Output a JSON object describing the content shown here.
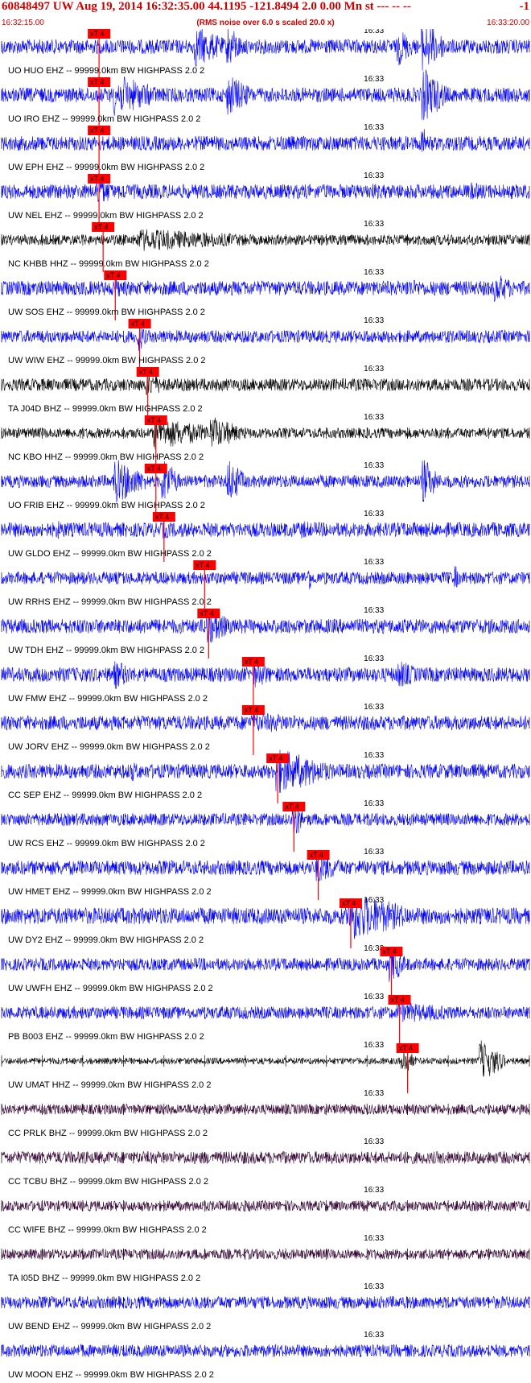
{
  "header": {
    "title": "60848497 UW Aug 19, 2014 16:32:35.00   44.1195 -121.8494  2.0 0.00 Mn st --- -- --",
    "trail": "-1",
    "start_time": "16:32:15.00",
    "end_time": "16:33:20.00",
    "subtitle": "(RMS noise over 6.0 s scaled 20.0 x)"
  },
  "colors": {
    "header": "#cc0000",
    "pick": "#ff0000",
    "blue_trace": "#0000ff",
    "black_trace": "#000000",
    "purple_trace": "#330033",
    "grid": "#000000"
  },
  "chart_data": {
    "type": "line",
    "title": "60848497 UW Aug 19, 2014 16:32:35.00   44.1195 -121.8494  2.0 0.00 Mn st --- -- --",
    "x_range": [
      "16:32:15.00",
      "16:33:20.00"
    ],
    "x_tick_label": "16:33",
    "x_tick_seconds": 45,
    "duration_seconds": 65,
    "pick_label": "xT 4",
    "series": [
      {
        "name": "UO.HUO.EHZ.--",
        "label": "UO HUO EHZ -- 99999.0km BW  HIGHPASS  2.0  2",
        "color": "blue",
        "pick_s": 12.0,
        "amp": 0.35,
        "events": [
          [
            24,
            4,
            1.0
          ],
          [
            28,
            2,
            1.0
          ],
          [
            49,
            2,
            0.9
          ],
          [
            52,
            3,
            1.2
          ],
          [
            61,
            3,
            0.4
          ]
        ]
      },
      {
        "name": "UO.IRO.EHZ.--",
        "label": "UO IRO EHZ -- 99999.0km BW  HIGHPASS  2.0  2",
        "color": "blue",
        "pick_s": 12.0,
        "amp": 0.35,
        "events": [
          [
            14,
            6,
            1.0
          ],
          [
            28,
            3,
            1.0
          ],
          [
            52,
            3,
            1.3
          ]
        ]
      },
      {
        "name": "UW.EPH.EHZ.--",
        "label": "UW EPH EHZ -- 99999.0km BW  HIGHPASS  2.0  2",
        "color": "blue",
        "pick_s": 12.0,
        "amp": 0.35,
        "events": [
          [
            52,
            0.5,
            0.8
          ]
        ]
      },
      {
        "name": "UW.NEL.EHZ.--",
        "label": "UW NEL EHZ -- 99999.0km BW  HIGHPASS  2.0  2",
        "color": "blue",
        "pick_s": 12.0,
        "amp": 0.35,
        "events": [
          [
            12,
            2,
            0.8
          ],
          [
            46,
            3,
            0.4
          ],
          [
            58,
            3,
            0.45
          ]
        ]
      },
      {
        "name": "NC.KHBB.HHZ.--",
        "label": "NC KHBB HHZ -- 99999.0km BW  HIGHPASS  2.0  2",
        "color": "black",
        "pick_s": 12.5,
        "amp": 0.25,
        "events": [
          [
            17,
            18,
            0.55
          ]
        ]
      },
      {
        "name": "UW.SOS.EHZ.--",
        "label": "UW SOS EHZ -- 99999.0km BW  HIGHPASS  2.0  2",
        "color": "blue",
        "pick_s": 14.0,
        "amp": 0.35,
        "events": [
          [
            14,
            2,
            0.5
          ],
          [
            50,
            6,
            0.45
          ],
          [
            61,
            3,
            0.7
          ]
        ]
      },
      {
        "name": "UW.WIW.EHZ.--",
        "label": "UW WIW EHZ -- 99999.0km BW  HIGHPASS  2.0  2",
        "color": "blue",
        "pick_s": 17.0,
        "amp": 0.3,
        "events": [
          [
            17,
            1,
            0.7
          ]
        ]
      },
      {
        "name": "TA.J04D.BHZ.--",
        "label": "TA J04D BHZ -- 99999.0km BW  HIGHPASS  2.0  2",
        "color": "black",
        "pick_s": 18.0,
        "amp": 0.3,
        "events": [
          [
            18,
            3,
            0.6
          ]
        ]
      },
      {
        "name": "NC.KBO.HHZ.--",
        "label": "NC KBO HHZ -- 99999.0km BW  HIGHPASS  2.0  2",
        "color": "black",
        "pick_s": 19.0,
        "amp": 0.25,
        "events": [
          [
            19,
            8,
            0.8
          ],
          [
            26,
            4,
            0.8
          ]
        ]
      },
      {
        "name": "UO.FRIB.EHZ.--",
        "label": "UO FRIB EHZ -- 99999.0km BW  HIGHPASS  2.0  2",
        "color": "blue",
        "pick_s": 19.0,
        "amp": 0.3,
        "events": [
          [
            14,
            4,
            1.1
          ],
          [
            20,
            2,
            1.1
          ],
          [
            28,
            2,
            1.1
          ],
          [
            52,
            2,
            1.1
          ]
        ]
      },
      {
        "name": "UW.GLDO.EHZ.--",
        "label": "UW GLDO EHZ -- 99999.0km BW  HIGHPASS  2.0  2",
        "color": "blue",
        "pick_s": 20.0,
        "amp": 0.35,
        "events": [
          [
            7,
            4,
            0.45
          ],
          [
            20,
            3,
            0.45
          ],
          [
            37,
            4,
            0.45
          ],
          [
            50,
            3,
            0.4
          ]
        ]
      },
      {
        "name": "UW.RRHS.EHZ.--",
        "label": "UW RRHS EHZ -- 99999.0km BW  HIGHPASS  2.0  2",
        "color": "blue",
        "pick_s": 25.0,
        "amp": 0.3,
        "events": [
          [
            25,
            5,
            0.3
          ],
          [
            38,
            0.4,
            0.6
          ],
          [
            56,
            0.4,
            0.6
          ]
        ]
      },
      {
        "name": "UW.TDH.EHZ.--",
        "label": "UW TDH EHZ -- 99999.0km BW  HIGHPASS  2.0  2",
        "color": "blue",
        "pick_s": 25.5,
        "amp": 0.35,
        "events": [
          [
            25.5,
            3,
            0.9
          ]
        ]
      },
      {
        "name": "UW.FMW.EHZ.--",
        "label": "UW FMW EHZ -- 99999.0km BW  HIGHPASS  2.0  2",
        "color": "blue",
        "pick_s": 31.0,
        "amp": 0.35,
        "events": [
          [
            14,
            3,
            0.7
          ],
          [
            31,
            3,
            0.7
          ],
          [
            49,
            3,
            0.7
          ]
        ]
      },
      {
        "name": "UW.JORV.EHZ.--",
        "label": "UW JORV EHZ -- 99999.0km BW  HIGHPASS  2.0  2",
        "color": "blue",
        "pick_s": 31.0,
        "amp": 0.35,
        "events": [
          [
            31,
            14,
            0.5
          ]
        ]
      },
      {
        "name": "CC.SEP.EHZ.--",
        "label": "CC SEP EHZ -- 99999.0km BW  HIGHPASS  2.0  2",
        "color": "blue",
        "pick_s": 34.0,
        "amp": 0.35,
        "events": [
          [
            34,
            7,
            1.1
          ],
          [
            16,
            2,
            0.5
          ]
        ]
      },
      {
        "name": "UW.RCS.EHZ.--",
        "label": "UW RCS EHZ -- 99999.0km BW  HIGHPASS  2.0  2",
        "color": "blue",
        "pick_s": 36.0,
        "amp": 0.3,
        "events": [
          [
            36,
            1.5,
            0.9
          ]
        ]
      },
      {
        "name": "UW.HMET.EHZ.--",
        "label": "UW HMET EHZ -- 99999.0km BW  HIGHPASS  2.0  2",
        "color": "blue",
        "pick_s": 39.0,
        "amp": 0.35,
        "events": [
          [
            39,
            4,
            0.7
          ]
        ]
      },
      {
        "name": "UW.DY2.EHZ.--",
        "label": "UW DY2 EHZ -- 99999.0km BW  HIGHPASS  2.0  2",
        "color": "blue",
        "pick_s": 43.0,
        "amp": 0.4,
        "events": [
          [
            43,
            8,
            1.2
          ]
        ]
      },
      {
        "name": "UW.UWFH.EHZ.--",
        "label": "UW UWFH EHZ -- 99999.0km BW  HIGHPASS  2.0  2",
        "color": "blue",
        "pick_s": 48.0,
        "amp": 0.3,
        "events": [
          [
            48,
            2,
            0.9
          ]
        ]
      },
      {
        "name": "PB.B003.EHZ.--",
        "label": "PB B003 EHZ -- 99999.0km BW  HIGHPASS  2.0  2",
        "color": "blue",
        "pick_s": 49.0,
        "amp": 0.3,
        "events": [
          [
            49,
            12,
            0.5
          ]
        ]
      },
      {
        "name": "UW.UMAT.HHZ.--",
        "label": "UW UMAT HHZ -- 99999.0km BW  HIGHPASS  2.0  2",
        "color": "black",
        "pick_s": 50.0,
        "amp": 0.15,
        "events": [
          [
            49.5,
            1.5,
            0.7
          ],
          [
            59,
            3,
            1.0
          ]
        ]
      },
      {
        "name": "CC.PRLK.BHZ.--",
        "label": "CC PRLK BHZ -- 99999.0km BW  HIGHPASS  2.0  2",
        "color": "purple",
        "amp": 0.25,
        "events": []
      },
      {
        "name": "CC.TCBU.BHZ.--",
        "label": "CC TCBU BHZ -- 99999.0km BW  HIGHPASS  2.0  2",
        "color": "purple",
        "amp": 0.3,
        "events": [
          [
            52,
            8,
            0.25
          ]
        ]
      },
      {
        "name": "CC.WIFE.BHZ.--",
        "label": "CC WIFE BHZ -- 99999.0km BW  HIGHPASS  2.0  2",
        "color": "purple",
        "amp": 0.25,
        "events": []
      },
      {
        "name": "TA.I05D.BHZ.--",
        "label": "TA I05D BHZ -- 99999.0km BW  HIGHPASS  2.0  2",
        "color": "purple",
        "amp": 0.25,
        "events": []
      },
      {
        "name": "UW.BEND.EHZ.--",
        "label": "UW BEND EHZ -- 99999.0km BW  HIGHPASS  2.0  2",
        "color": "blue",
        "amp": 0.3,
        "events": []
      },
      {
        "name": "UW.MOON.EHZ.--",
        "label": "UW MOON EHZ -- 99999.0km BW  HIGHPASS  2.0  2",
        "color": "blue",
        "amp": 0.3,
        "events": []
      }
    ]
  }
}
